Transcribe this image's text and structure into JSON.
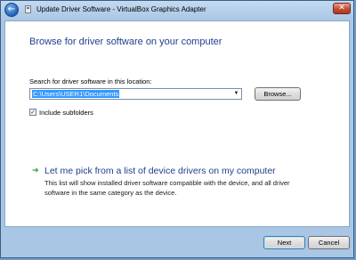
{
  "window": {
    "title": "Update Driver Software - VirtualBox Graphics Adapter",
    "back_glyph": "←",
    "close_glyph": "✕"
  },
  "main": {
    "heading": "Browse for driver software on your computer",
    "search_label": "Search for driver software in this location:",
    "path_value": "C:\\Users\\USER1\\Documents",
    "combo_arrow": "▼",
    "browse_label": "Browse...",
    "include_subfolders_label": "Include subfolders",
    "include_subfolders_checked": true,
    "check_glyph": "✓",
    "pick_arrow": "➔",
    "pick_title": "Let me pick from a list of device drivers on my computer",
    "pick_description": "This list will show installed driver software compatible with the device, and all driver software in the same category as the device."
  },
  "footer": {
    "next_label": "Next",
    "cancel_label": "Cancel"
  },
  "colors": {
    "heading_blue": "#1e3e8c",
    "selection_blue": "#3399ff",
    "link_arrow_green": "#2f9a2f"
  }
}
